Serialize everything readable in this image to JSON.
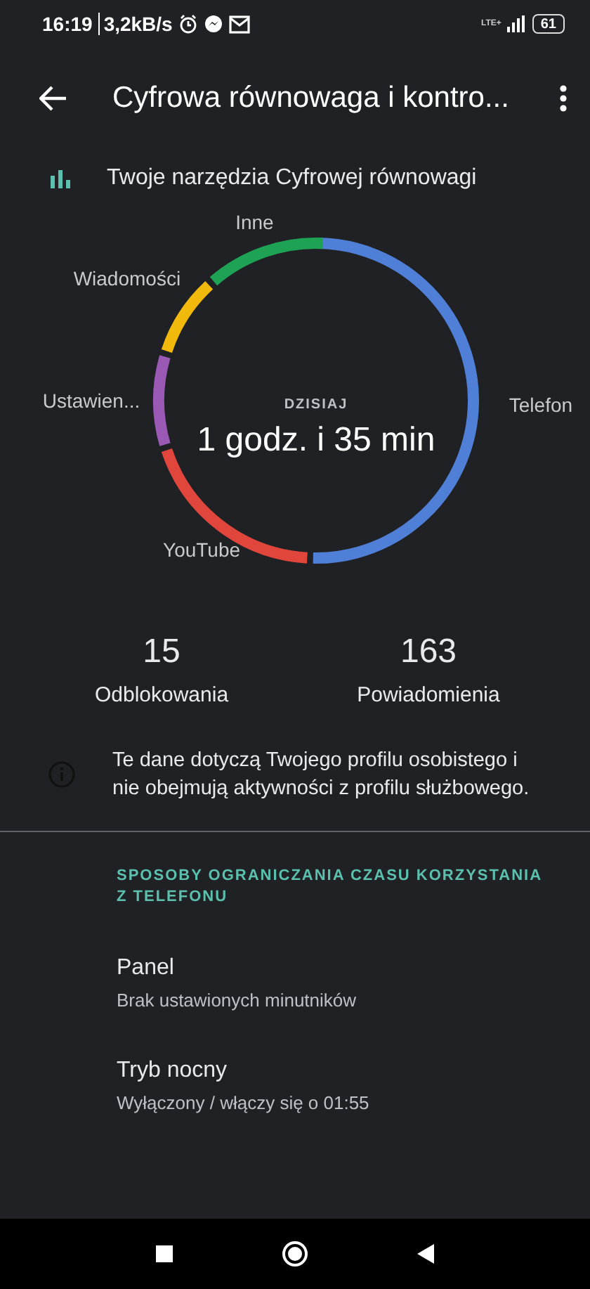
{
  "status_bar": {
    "time": "16:19",
    "speed": "3,2kB/s",
    "network": "LTE+",
    "battery": "61"
  },
  "app_bar": {
    "title": "Cyfrowa równowaga i kontro..."
  },
  "tools_header": {
    "label": "Twoje narzędzia Cyfrowej równowagi"
  },
  "usage": {
    "caption": "DZISIAJ",
    "total": "1 godz. i 35 min",
    "segments": [
      {
        "label": "Telefon",
        "color": "#4f7fd6"
      },
      {
        "label": "YouTube",
        "color": "#e0463b"
      },
      {
        "label": "Ustawien...",
        "color": "#9b59b6"
      },
      {
        "label": "Wiadomości",
        "color": "#f2b90d"
      },
      {
        "label": "Inne",
        "color": "#1ea355"
      }
    ]
  },
  "stats": [
    {
      "value": "15",
      "label": "Odblokowania"
    },
    {
      "value": "163",
      "label": "Powiadomienia"
    }
  ],
  "info": {
    "text": "Te dane dotyczą Twojego profilu osobistego i nie obejmują aktywności z profilu służbowego."
  },
  "section": {
    "title": "SPOSOBY OGRANICZANIA CZASU KORZYSTANIA Z TELEFONU",
    "items": [
      {
        "title": "Panel",
        "subtitle": "Brak ustawionych minutników"
      },
      {
        "title": "Tryb nocny",
        "subtitle": "Wyłączony / włączy się o 01:55"
      }
    ]
  }
}
